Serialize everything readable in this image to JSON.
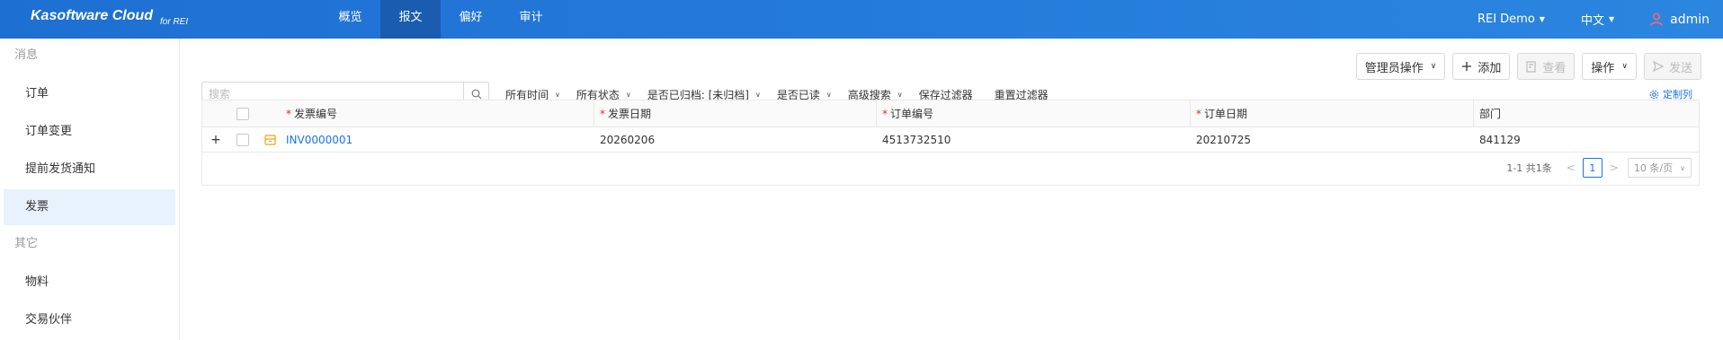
{
  "header": {
    "brand": "Kasoftware Cloud",
    "brand_sub": "for REI",
    "nav": [
      "概览",
      "报文",
      "偏好",
      "审计"
    ],
    "active_nav": "报文",
    "workspace": "REI Demo",
    "language": "中文",
    "user": "admin"
  },
  "sidebar": {
    "groups": [
      {
        "label": "消息",
        "items": [
          "订单",
          "订单变更",
          "提前发货通知",
          "发票"
        ]
      },
      {
        "label": "其它",
        "items": [
          "物料",
          "交易伙伴"
        ]
      }
    ],
    "active_item": "发票"
  },
  "toolbar": {
    "admin_ops": "管理员操作",
    "add": "添加",
    "view": "查看",
    "ops": "操作",
    "send": "发送"
  },
  "filters": {
    "search_placeholder": "搜索",
    "time": "所有时间",
    "status": "所有状态",
    "archived": "是否已归档: [未归档]",
    "read": "是否已读",
    "advanced": "高级搜索",
    "save_filter": "保存过滤器",
    "reset_filter": "重置过滤器"
  },
  "customize_columns": "定制列",
  "table": {
    "columns": [
      {
        "label": "发票编号",
        "required": true
      },
      {
        "label": "发票日期",
        "required": true
      },
      {
        "label": "订单编号",
        "required": true
      },
      {
        "label": "订单日期",
        "required": true
      },
      {
        "label": "部门",
        "required": false
      }
    ],
    "rows": [
      {
        "expand": "+",
        "invoice_no": "INV0000001",
        "invoice_date": "20260206",
        "order_no": "4513732510",
        "order_date": "20210725",
        "dept": "841129"
      }
    ]
  },
  "pagination": {
    "summary": "1-1 共1条",
    "current_page": "1",
    "page_size": "10 条/页"
  },
  "colors": {
    "topbar": "#1e6fd2",
    "accent": "#1a73e8",
    "required": "#ee2233",
    "active_side": "#e8f2fd"
  }
}
